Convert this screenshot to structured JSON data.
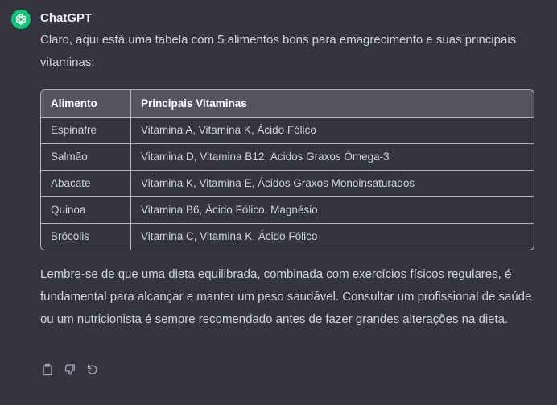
{
  "message": {
    "author": "ChatGPT",
    "intro": "Claro, aqui está uma tabela com 5 alimentos bons para emagrecimento e suas principais vitaminas:",
    "outro": "Lembre-se de que uma dieta equilibrada, combinada com exercícios físicos regulares, é fundamental para alcançar e manter um peso saudável. Consultar um profissional de saúde ou um nutricionista é sempre recomendado antes de fazer grandes alterações na dieta."
  },
  "table": {
    "headers": [
      "Alimento",
      "Principais Vitaminas"
    ],
    "rows": [
      [
        "Espinafre",
        "Vitamina A, Vitamina K, Ácido Fólico"
      ],
      [
        "Salmão",
        "Vitamina D, Vitamina B12, Ácidos Graxos Ômega-3"
      ],
      [
        "Abacate",
        "Vitamina K, Vitamina E, Ácidos Graxos Monoinsaturados"
      ],
      [
        "Quinoa",
        "Vitamina B6, Ácido Fólico, Magnésio"
      ],
      [
        "Brócolis",
        "Vitamina C, Vitamina K, Ácido Fólico"
      ]
    ]
  },
  "icons": {
    "avatar": "openai-logo-icon",
    "copy": "clipboard-icon",
    "dislike": "thumbs-down-icon",
    "regenerate": "regenerate-icon"
  },
  "colors": {
    "background": "#343541",
    "avatar": "#19c37d",
    "header_row": "#555561"
  }
}
